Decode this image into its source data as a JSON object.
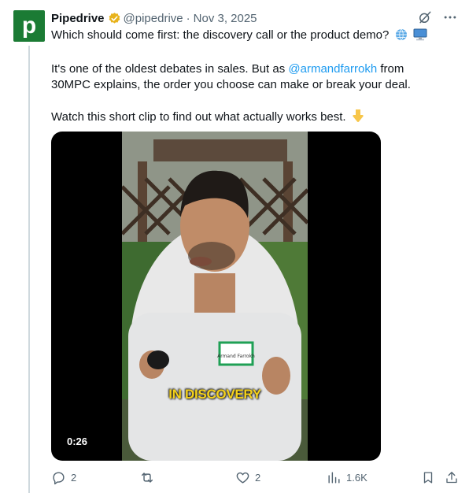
{
  "author": {
    "avatar_letter": "p",
    "avatar_color": "#1b7b34",
    "name": "Pipedrive",
    "verified_badge": "gold-verified-badge",
    "handle": "@pipedrive",
    "separator": "·",
    "date": "Nov 3, 2025"
  },
  "top_icons": [
    "grok-icon",
    "more-icon"
  ],
  "tweet": {
    "line1": "Which should come first: the discovery call or the product demo?",
    "line1_emojis": [
      "globe-emoji",
      "computer-emoji"
    ],
    "para2_before": "It's one of the oldest debates in sales. But as ",
    "mention": "@armandfarrokh",
    "para2_after": " from 30MPC explains, the order you choose can make or break your deal.",
    "para3": "Watch this short clip to find out what actually works best.",
    "para3_emoji": "pointing-down-emoji"
  },
  "video": {
    "caption": "IN DISCOVERY",
    "duration": "0:26",
    "name_tag": "Armand Farrokh"
  },
  "actions": {
    "replies": "2",
    "retweets": "",
    "likes": "2",
    "views": "1.6K"
  },
  "colors": {
    "link": "#1d9bf0",
    "muted": "#536471",
    "caption": "#f5d21b"
  }
}
